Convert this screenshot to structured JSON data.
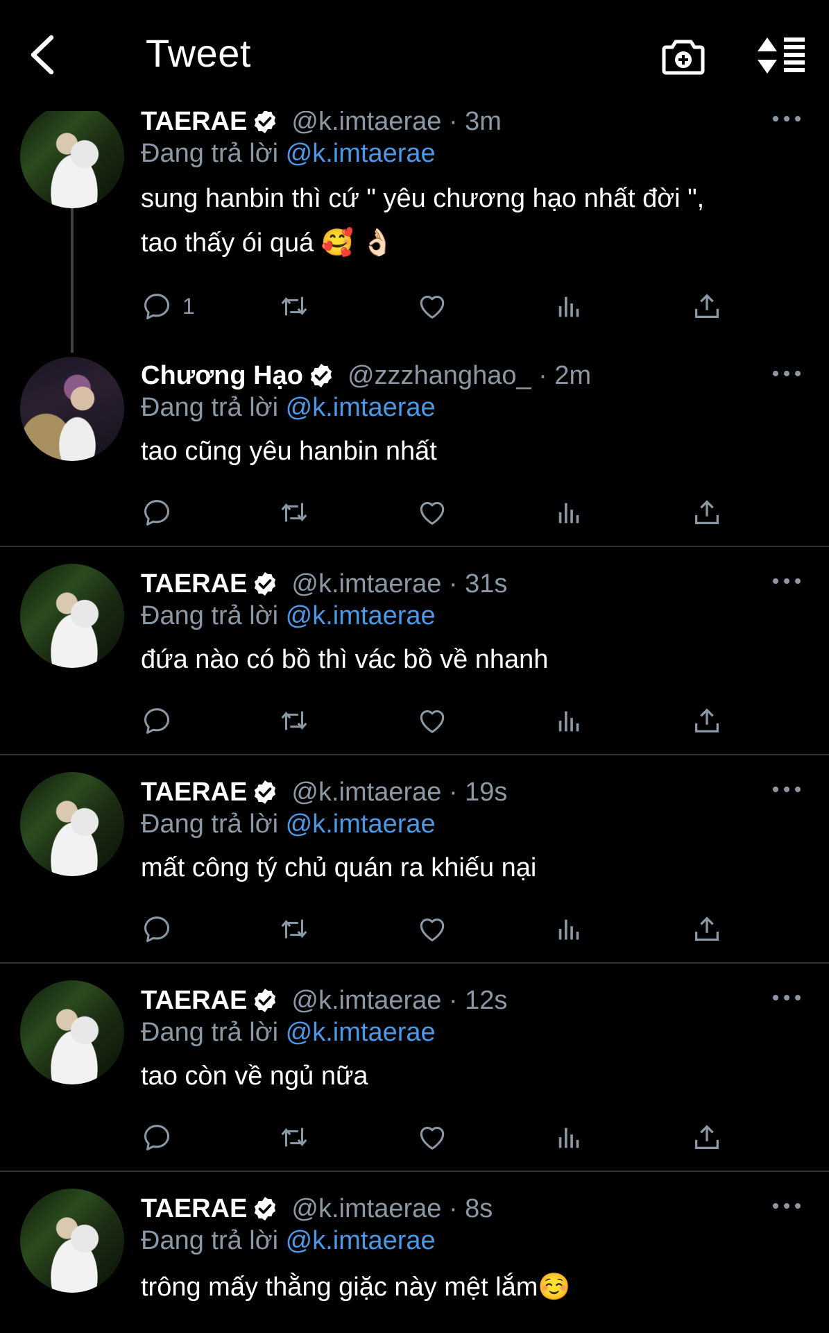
{
  "header": {
    "title": "Tweet",
    "back_icon": "chevron-left-icon",
    "camera_icon": "camera-plus-icon",
    "sort_icon": "sort-list-icon"
  },
  "reply_prefix": "Đang trả lời",
  "tweets": [
    {
      "name": "TAERAE",
      "handle_time": "@k.imtaerae · 3m",
      "mention": "@k.imtaerae",
      "text_line1": "sung hanbin thì cứ \" yêu chương hạo nhất đời \",",
      "text_line2": "tao thấy ói quá 🥰 👌🏻",
      "reply_count": "1"
    },
    {
      "name": "Chương Hạo",
      "handle_time": "@zzzhanghao_ · 2m",
      "mention": "@k.imtaerae",
      "text_line1": "tao cũng yêu hanbin nhất",
      "reply_count": ""
    },
    {
      "name": "TAERAE",
      "handle_time": "@k.imtaerae · 31s",
      "mention": "@k.imtaerae",
      "text_line1": "đứa nào có bồ thì vác bồ về nhanh",
      "reply_count": ""
    },
    {
      "name": "TAERAE",
      "handle_time": "@k.imtaerae · 19s",
      "mention": "@k.imtaerae",
      "text_line1": "mất công tý chủ quán ra khiếu nại",
      "reply_count": ""
    },
    {
      "name": "TAERAE",
      "handle_time": "@k.imtaerae · 12s",
      "mention": "@k.imtaerae",
      "text_line1": "tao còn về ngủ nữa",
      "reply_count": ""
    },
    {
      "name": "TAERAE",
      "handle_time": "@k.imtaerae · 8s",
      "mention": "@k.imtaerae",
      "text_line1": "trông mấy thằng giặc này mệt lắm☺️",
      "reply_count": ""
    }
  ],
  "colors": {
    "background": "#000000",
    "text": "#ffffff",
    "secondary": "#8b98a5",
    "mention": "#4a99e9",
    "divider": "#2f3336",
    "verified_badge": "#ffffff"
  }
}
